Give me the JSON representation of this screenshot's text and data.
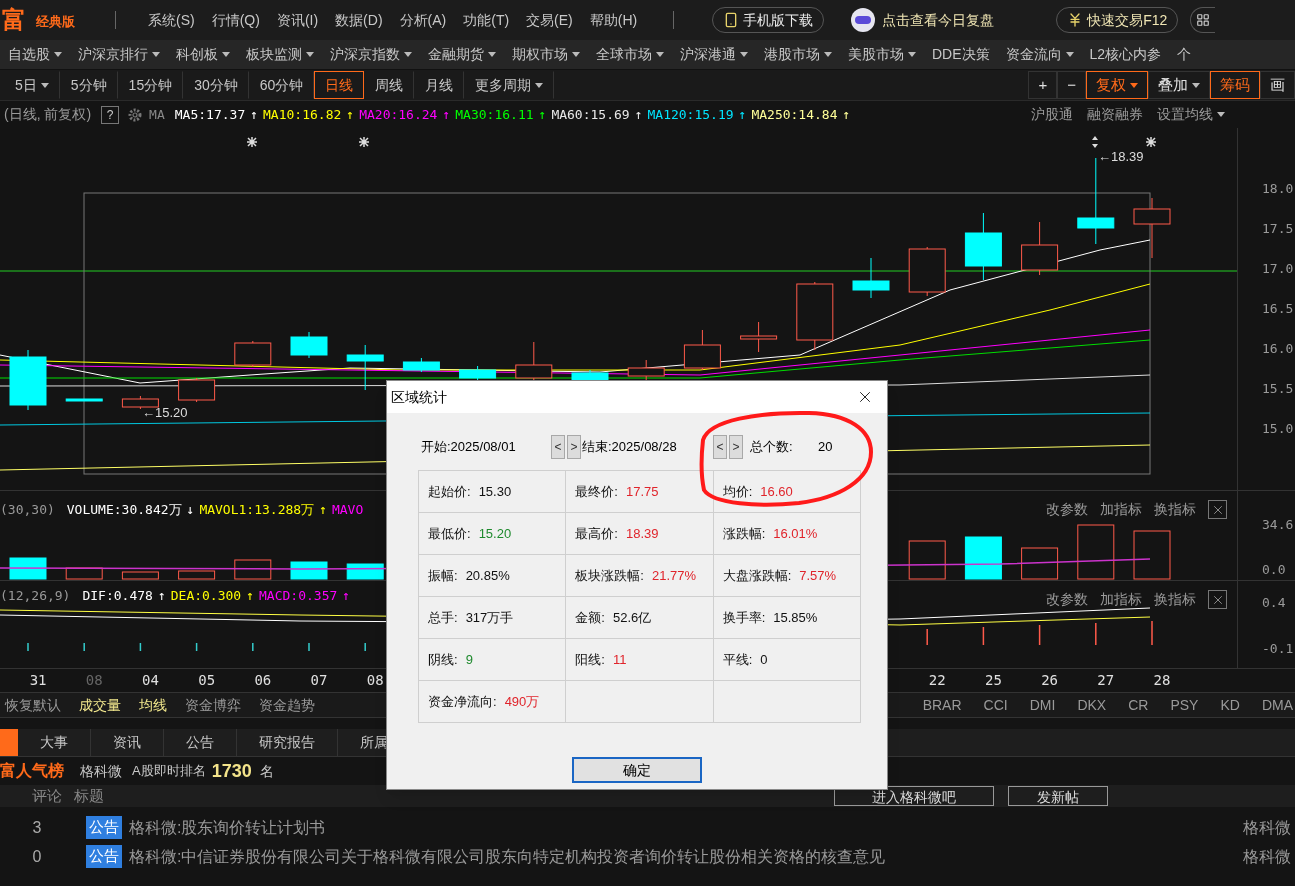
{
  "header": {
    "logo": "富",
    "edition": "经典版",
    "menu": [
      "系统(S)",
      "行情(Q)",
      "资讯(I)",
      "数据(D)",
      "分析(A)",
      "功能(T)",
      "交易(E)",
      "帮助(H)"
    ],
    "phone_button": "手机版下载",
    "review_link": "点击查看今日复盘",
    "trade_button": "快速交易F12"
  },
  "nav": [
    {
      "label": "自选股",
      "dropdown": true
    },
    {
      "label": "沪深京排行",
      "dropdown": true
    },
    {
      "label": "科创板",
      "dropdown": true
    },
    {
      "label": "板块监测",
      "dropdown": true
    },
    {
      "label": "沪深京指数",
      "dropdown": true
    },
    {
      "label": "金融期货",
      "dropdown": true
    },
    {
      "label": "期权市场",
      "dropdown": true
    },
    {
      "label": "全球市场",
      "dropdown": true
    },
    {
      "label": "沪深港通",
      "dropdown": true
    },
    {
      "label": "港股市场",
      "dropdown": true
    },
    {
      "label": "美股市场",
      "dropdown": true
    },
    {
      "label": "DDE决策",
      "dropdown": false
    },
    {
      "label": "资金流向",
      "dropdown": true
    },
    {
      "label": "L2核心内参",
      "dropdown": false
    },
    {
      "label": "个",
      "dropdown": false
    }
  ],
  "periods": [
    {
      "label": "5日",
      "selected": false,
      "dropdown": true
    },
    {
      "label": "5分钟",
      "selected": false,
      "dropdown": false
    },
    {
      "label": "15分钟",
      "selected": false,
      "dropdown": false
    },
    {
      "label": "30分钟",
      "selected": false,
      "dropdown": false
    },
    {
      "label": "60分钟",
      "selected": false,
      "dropdown": false
    },
    {
      "label": "日线",
      "selected": true,
      "dropdown": false
    },
    {
      "label": "周线",
      "selected": false,
      "dropdown": false
    },
    {
      "label": "月线",
      "selected": false,
      "dropdown": false
    },
    {
      "label": "更多周期",
      "selected": false,
      "dropdown": true
    }
  ],
  "tools": [
    {
      "label": "+",
      "kind": "plain",
      "dropdown": false
    },
    {
      "label": "−",
      "kind": "plain",
      "dropdown": false
    },
    {
      "label": "复权",
      "kind": "accent",
      "dropdown": true
    },
    {
      "label": "叠加",
      "kind": "plain",
      "dropdown": true
    },
    {
      "label": "筹码",
      "kind": "accent",
      "dropdown": false
    },
    {
      "label": "画",
      "kind": "plain",
      "dropdown": false
    }
  ],
  "ma_legend": {
    "mode": "(日线, 前复权)",
    "help": "?",
    "prefix": "MA",
    "items": [
      {
        "label": "MA5:17.37",
        "color": "#ffffff",
        "arrow": "↑"
      },
      {
        "label": "MA10:16.82",
        "color": "#ffff00",
        "arrow": "↑"
      },
      {
        "label": "MA20:16.24",
        "color": "#ff00ff",
        "arrow": "↑"
      },
      {
        "label": "MA30:16.11",
        "color": "#00ff00",
        "arrow": "↑"
      },
      {
        "label": "MA60:15.69",
        "color": "#e8e8e8",
        "arrow": "↑"
      },
      {
        "label": "MA120:15.19",
        "color": "#00e5ff",
        "arrow": "↑"
      },
      {
        "label": "MA250:14.84",
        "color": "#ffff99",
        "arrow": "↑"
      }
    ],
    "links": [
      "沪股通",
      "融资融券"
    ],
    "setting": "设置均线"
  },
  "price_chart": {
    "axis": [
      "18.0",
      "17.5",
      "17.0",
      "16.5",
      "16.0",
      "15.5",
      "15.0"
    ],
    "high_note": "←18.39",
    "low_note": "←15.20"
  },
  "volume_panel": {
    "params": "(30,30)",
    "items": [
      {
        "label": "VOLUME:30.842万",
        "color": "#ffffff",
        "arrow": "↓"
      },
      {
        "label": "MAVOL1:13.288万",
        "color": "#ffff00",
        "arrow": "↑"
      },
      {
        "label": "MAVO",
        "color": "#ff00ff"
      }
    ],
    "actions": [
      "改参数",
      "加指标",
      "换指标"
    ],
    "axis": [
      "34.6",
      "0.0"
    ]
  },
  "macd_panel": {
    "params": "(12,26,9)",
    "items": [
      {
        "label": "DIF:0.478",
        "color": "#ffffff",
        "arrow": "↑"
      },
      {
        "label": "DEA:0.300",
        "color": "#ffff00",
        "arrow": "↑"
      },
      {
        "label": "MACD:0.357",
        "color": "#ff00ff",
        "arrow": "↑"
      }
    ],
    "actions": [
      "改参数",
      "加指标",
      "换指标"
    ],
    "axis": [
      "0.4",
      "-0.1"
    ]
  },
  "dates_left": [
    {
      "label": "31",
      "muted": false
    },
    {
      "label": "08",
      "muted": true
    },
    {
      "label": "04",
      "muted": false
    },
    {
      "label": "05",
      "muted": false
    },
    {
      "label": "06",
      "muted": false
    },
    {
      "label": "07",
      "muted": false
    },
    {
      "label": "08",
      "muted": false
    }
  ],
  "dates_right": [
    {
      "label": "22",
      "muted": false
    },
    {
      "label": "25",
      "muted": false
    },
    {
      "label": "26",
      "muted": false
    },
    {
      "label": "27",
      "muted": false
    },
    {
      "label": "28",
      "muted": false
    }
  ],
  "indicator_tabs": {
    "left": [
      {
        "label": "恢复默认",
        "selected": false
      },
      {
        "label": "成交量",
        "selected": true
      },
      {
        "label": "均线",
        "selected": true
      },
      {
        "label": "资金博弈",
        "selected": false
      },
      {
        "label": "资金趋势",
        "selected": false
      }
    ],
    "right": [
      "BRAR",
      "CCI",
      "DMI",
      "DKX",
      "CR",
      "PSY",
      "KD",
      "DMA"
    ]
  },
  "info_tabs": [
    "大事",
    "资讯",
    "公告",
    "研究报告",
    "所属"
  ],
  "popularity": {
    "title": "富人气榜",
    "stock": "格科微",
    "rank_label": "A股即时排名",
    "rank": "1730",
    "unit": "名"
  },
  "posts": {
    "columns": [
      "评论",
      "标题"
    ],
    "buttons": [
      "进入格科微吧",
      "发新帖"
    ],
    "rows": [
      {
        "comments": "3",
        "tag": "公告",
        "title": "格科微:股东询价转让计划书",
        "source": "格科微"
      },
      {
        "comments": "0",
        "tag": "公告",
        "title": "格科微:中信证券股份有限公司关于格科微有限公司股东向特定机构投资者询价转让股份相关资格的核查意见",
        "source": "格科微"
      }
    ]
  },
  "dialog": {
    "title": "区域统计",
    "start": "开始:2025/08/01",
    "end": "结束:2025/08/28",
    "prev": "<",
    "next": ">",
    "count_label": "总个数:",
    "count": "20",
    "cells": [
      {
        "kind": "stat",
        "label": "起始价:",
        "value": "15.30",
        "color": "#111111"
      },
      {
        "kind": "stat",
        "label": "最终价:",
        "value": "17.75",
        "color": "#e0242b"
      },
      {
        "kind": "stat",
        "label": "均价:",
        "value": "16.60",
        "color": "#e0242b"
      },
      {
        "kind": "stat",
        "label": "最低价:",
        "value": "15.20",
        "color": "#1f8a2e"
      },
      {
        "kind": "stat",
        "label": "最高价:",
        "value": "18.39",
        "color": "#e0242b"
      },
      {
        "kind": "stat",
        "label": "涨跌幅:",
        "value": "16.01%",
        "color": "#e0242b"
      },
      {
        "kind": "stat",
        "label": "振幅:",
        "value": "20.85%",
        "color": "#111111"
      },
      {
        "kind": "stat",
        "label": "板块涨跌幅:",
        "value": "21.77%",
        "color": "#e0242b"
      },
      {
        "kind": "stat",
        "label": "大盘涨跌幅:",
        "value": "7.57%",
        "color": "#e0242b"
      },
      {
        "kind": "stat",
        "label": "总手:",
        "value": "317万手",
        "color": "#111111"
      },
      {
        "kind": "stat",
        "label": "金额:",
        "value": "52.6亿",
        "color": "#111111"
      },
      {
        "kind": "stat",
        "label": "换手率:",
        "value": "15.85%",
        "color": "#111111"
      },
      {
        "kind": "stat",
        "label": "阴线:",
        "value": "9",
        "color": "#1f8a2e"
      },
      {
        "kind": "stat",
        "label": "阳线:",
        "value": "11",
        "color": "#e0242b"
      },
      {
        "kind": "stat",
        "label": "平线:",
        "value": "0",
        "color": "#111111"
      },
      {
        "kind": "stat",
        "label": "资金净流向:",
        "value": "490万",
        "color": "#e0242b"
      },
      {
        "kind": "empty"
      },
      {
        "kind": "empty"
      }
    ],
    "ok": "确定"
  }
}
